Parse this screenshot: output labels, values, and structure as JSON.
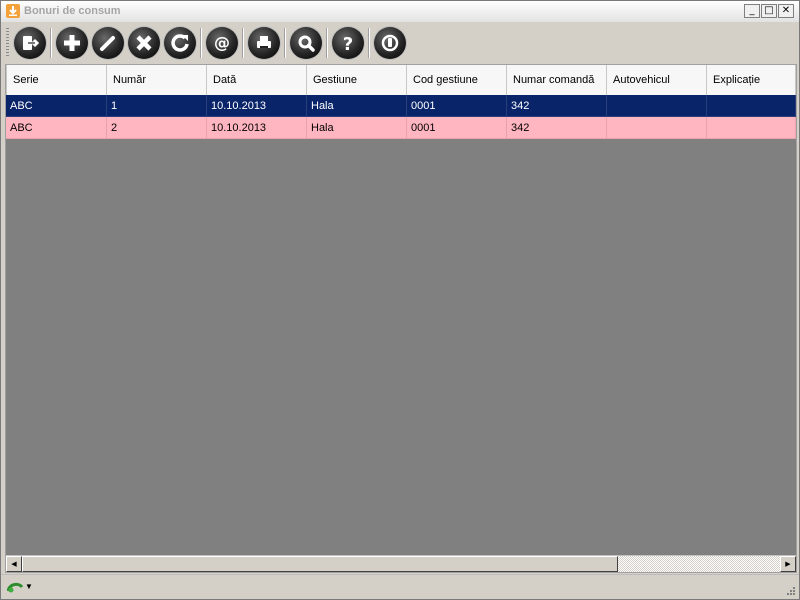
{
  "window": {
    "title": "Bonuri de consum",
    "controls": {
      "minimize": "_",
      "maximize": "□",
      "close": "✕"
    }
  },
  "toolbar": {
    "buttons": [
      {
        "name": "exit-icon"
      },
      {
        "name": "add-icon"
      },
      {
        "name": "edit-icon"
      },
      {
        "name": "delete-icon"
      },
      {
        "name": "refresh-icon"
      },
      {
        "name": "email-icon"
      },
      {
        "name": "print-icon"
      },
      {
        "name": "search-icon"
      },
      {
        "name": "help-icon"
      },
      {
        "name": "power-icon"
      }
    ]
  },
  "grid": {
    "columns": [
      "Serie",
      "Număr",
      "Dată",
      "Gestiune",
      "Cod gestiune",
      "Numar comandă",
      "Autovehicul",
      "Explicație"
    ],
    "rows": [
      {
        "serie": "ABC",
        "numar": "1",
        "data": "10.10.2013",
        "gestiune": "Hala",
        "cod_gestiune": "0001",
        "numar_comanda": "342",
        "autovehicul": "",
        "explicatie": "",
        "state": "selected"
      },
      {
        "serie": "ABC",
        "numar": "2",
        "data": "10.10.2013",
        "gestiune": "Hala",
        "cod_gestiune": "0001",
        "numar_comanda": "342",
        "autovehicul": "",
        "explicatie": "",
        "state": "highlighted"
      }
    ]
  },
  "colors": {
    "selected_row": "#0a246a",
    "highlighted_row": "#ffb6c1",
    "grid_background": "#808080"
  }
}
